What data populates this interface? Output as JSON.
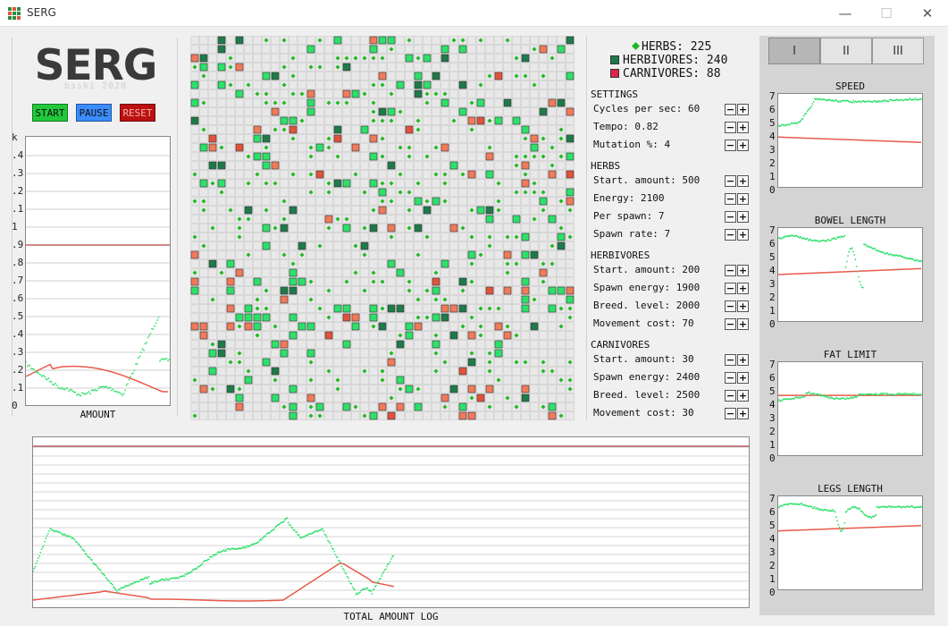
{
  "window": {
    "title": "SERG",
    "minimize_glyph": "—",
    "maximize_glyph": "☐",
    "close_glyph": "✕"
  },
  "brand": {
    "logo": "SERG",
    "subtitle": "bsski 2020"
  },
  "controls": {
    "start": "START",
    "pause": "PAUSE",
    "reset": "RESET"
  },
  "colors": {
    "herb": "#22b822",
    "herbivore": "#1f7a4a",
    "herbivore_light": "#2ee06a",
    "carnivore": "#e0533a",
    "grid_bg": "#d8d8d8",
    "cell": "#e8e8e8",
    "start": "#22c83c",
    "pause": "#3a8cff",
    "reset": "#bb1111",
    "threshold": "#9b1414"
  },
  "amount_chart": {
    "title": "AMOUNT",
    "y_axis_labels": [
      "k",
      ".4",
      ".3",
      ".2",
      ".1",
      "1",
      ".9",
      ".8",
      ".7",
      ".6",
      ".5",
      ".4",
      ".3",
      ".2",
      ".1",
      "0"
    ],
    "threshold_label_index": 6
  },
  "legend": {
    "herbs": "HERBS: 225",
    "herbivores": "HERBIVORES: 240",
    "carnivores": "CARNIVORES: 88"
  },
  "settings": {
    "header": "SETTINGS",
    "general": [
      {
        "label": "Cycles per sec: 60"
      },
      {
        "label": "Tempo: 0.82"
      },
      {
        "label": "Mutation %: 4"
      }
    ],
    "herbs_header": "HERBS",
    "herbs": [
      {
        "label": "Start. amount: 500"
      },
      {
        "label": "Energy: 2100"
      },
      {
        "label": "Per spawn: 7"
      },
      {
        "label": "Spawn rate: 7"
      }
    ],
    "herbivores_header": "HERBIVORES",
    "herbivores": [
      {
        "label": "Start. amount: 200"
      },
      {
        "label": "Spawn energy: 1900"
      },
      {
        "label": "Breed. level: 2000"
      },
      {
        "label": "Movement cost: 70"
      }
    ],
    "carnivores_header": "CARNIVORES",
    "carnivores": [
      {
        "label": "Start. amount: 30"
      },
      {
        "label": "Spawn energy: 2400"
      },
      {
        "label": "Breed. level: 2500"
      },
      {
        "label": "Movement cost: 30"
      }
    ],
    "minus_glyph": "−",
    "plus_glyph": "+"
  },
  "tabs": [
    {
      "label": "I",
      "active": true
    },
    {
      "label": "II",
      "active": false
    },
    {
      "label": "III",
      "active": false
    }
  ],
  "gene_charts": [
    {
      "title": "SPEED",
      "ylim": [
        0,
        7
      ]
    },
    {
      "title": "BOWEL LENGTH",
      "ylim": [
        0,
        7
      ]
    },
    {
      "title": "FAT LIMIT",
      "ylim": [
        0,
        7
      ]
    },
    {
      "title": "LEGS LENGTH",
      "ylim": [
        0,
        7
      ]
    }
  ],
  "gene_y_labels": [
    "7",
    "6",
    "5",
    "4",
    "3",
    "2",
    "1",
    "0"
  ],
  "log_chart": {
    "title": "TOTAL AMOUNT LOG"
  }
}
